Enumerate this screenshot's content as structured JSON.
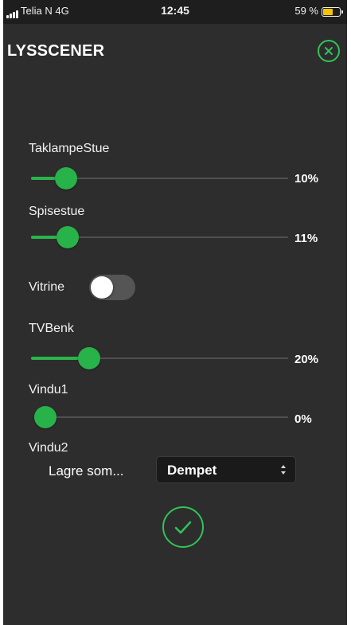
{
  "status_bar": {
    "carrier": "Telia N  4G",
    "time": "12:45",
    "battery": "59 %",
    "battery_level": 0.59,
    "battery_color": "#f5c400"
  },
  "header": {
    "title": "LYSSCENER",
    "close_icon": "close-circle-icon"
  },
  "lights": [
    {
      "name": "TaklampeStue",
      "type": "slider",
      "value_label": "10%",
      "level": 0.1
    },
    {
      "name": "Spisestue",
      "type": "slider",
      "value_label": "11%",
      "level": 0.11
    },
    {
      "name": "Vitrine",
      "type": "toggle",
      "on": false
    },
    {
      "name": "TVBenk",
      "type": "slider",
      "value_label": "20%",
      "level": 0.2
    },
    {
      "name": "Vindu1",
      "type": "slider",
      "value_label": "0%",
      "level": 0.0
    },
    {
      "name": "Vindu2",
      "type": "label"
    }
  ],
  "save": {
    "label": "Lagre som...",
    "selected": "Dempet"
  },
  "confirm_icon": "checkmark-circle-icon",
  "colors": {
    "accent": "#2cb44c",
    "background": "#2d2d2d"
  }
}
